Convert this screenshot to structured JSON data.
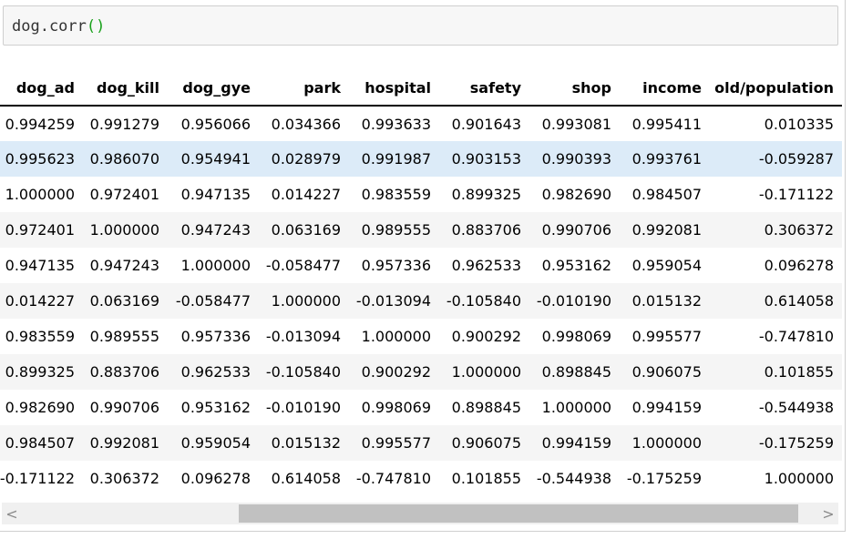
{
  "code_cell": {
    "code_prefix": "dog.corr",
    "code_parens": "()"
  },
  "output_table": {
    "columns": [
      "dog_ad",
      "dog_kill",
      "dog_gye",
      "park",
      "hospital",
      "safety",
      "shop",
      "income",
      "old/population"
    ],
    "rows": [
      [
        "0.994259",
        "0.991279",
        "0.956066",
        "0.034366",
        "0.993633",
        "0.901643",
        "0.993081",
        "0.995411",
        "0.010335"
      ],
      [
        "0.995623",
        "0.986070",
        "0.954941",
        "0.028979",
        "0.991987",
        "0.903153",
        "0.990393",
        "0.993761",
        "-0.059287"
      ],
      [
        "1.000000",
        "0.972401",
        "0.947135",
        "0.014227",
        "0.983559",
        "0.899325",
        "0.982690",
        "0.984507",
        "-0.171122"
      ],
      [
        "0.972401",
        "1.000000",
        "0.947243",
        "0.063169",
        "0.989555",
        "0.883706",
        "0.990706",
        "0.992081",
        "0.306372"
      ],
      [
        "0.947135",
        "0.947243",
        "1.000000",
        "-0.058477",
        "0.957336",
        "0.962533",
        "0.953162",
        "0.959054",
        "0.096278"
      ],
      [
        "0.014227",
        "0.063169",
        "-0.058477",
        "1.000000",
        "-0.013094",
        "-0.105840",
        "-0.010190",
        "0.015132",
        "0.614058"
      ],
      [
        "0.983559",
        "0.989555",
        "0.957336",
        "-0.013094",
        "1.000000",
        "0.900292",
        "0.998069",
        "0.995577",
        "-0.747810"
      ],
      [
        "0.899325",
        "0.883706",
        "0.962533",
        "-0.105840",
        "0.900292",
        "1.000000",
        "0.898845",
        "0.906075",
        "0.101855"
      ],
      [
        "0.982690",
        "0.990706",
        "0.953162",
        "-0.010190",
        "0.998069",
        "0.898845",
        "1.000000",
        "0.994159",
        "-0.544938"
      ],
      [
        "0.984507",
        "0.992081",
        "0.959054",
        "0.015132",
        "0.995577",
        "0.906075",
        "0.994159",
        "1.000000",
        "-0.175259"
      ],
      [
        "-0.171122",
        "0.306372",
        "0.096278",
        "0.614058",
        "-0.747810",
        "0.101855",
        "-0.544938",
        "-0.175259",
        "1.000000"
      ]
    ],
    "highlighted_row": 1
  },
  "scrollbar": {
    "left_arrow": "<",
    "right_arrow": ">",
    "thumb_start_fraction": 0.29,
    "thumb_end_fraction": 0.975
  }
}
